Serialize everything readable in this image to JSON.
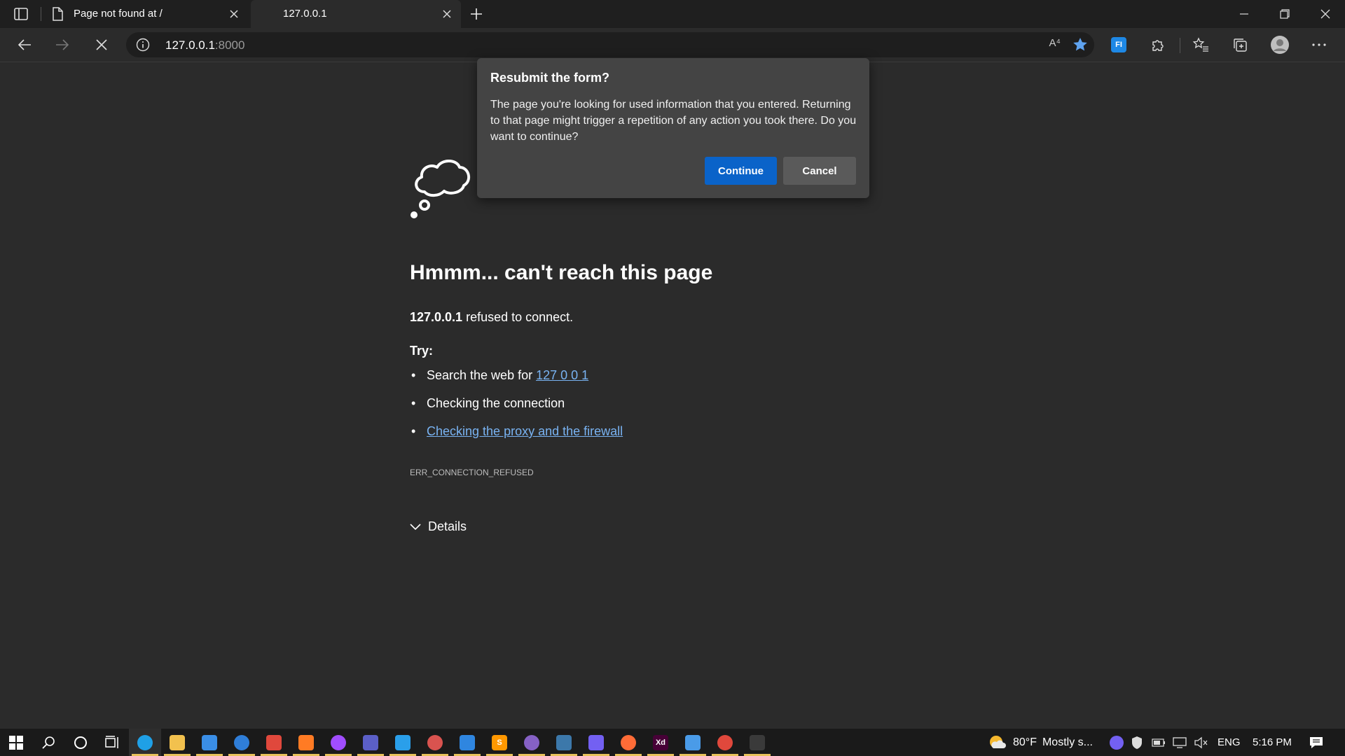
{
  "browser": {
    "tabs": [
      {
        "title": "Page not found at /",
        "active": false
      },
      {
        "title": "127.0.0.1",
        "active": true
      }
    ],
    "address": {
      "host": "127.0.0.1",
      "port": ":8000"
    },
    "read_aloud_glyph": "A⁴"
  },
  "error_page": {
    "heading": "Hmmm... can't reach this page",
    "host": "127.0.0.1",
    "refused_text": " refused to connect.",
    "try_label": "Try:",
    "suggestions": [
      {
        "prefix": "Search the web for ",
        "link": "127 0 0 1"
      },
      {
        "prefix": "Checking the connection",
        "link": ""
      },
      {
        "prefix": "",
        "link": "Checking the proxy and the firewall"
      }
    ],
    "error_code": "ERR_CONNECTION_REFUSED",
    "details_label": "Details"
  },
  "dialog": {
    "title": "Resubmit the form?",
    "message": "The page you're looking for used information that you entered. Returning to that page might trigger a repetition of any action you took there. Do you want to continue?",
    "continue_label": "Continue",
    "cancel_label": "Cancel"
  },
  "taskbar": {
    "apps": [
      {
        "name": "edge",
        "label": "",
        "color": "#1fa0e6",
        "active": true
      },
      {
        "name": "file-explorer",
        "label": "",
        "color": "#f2c14e",
        "active": false
      },
      {
        "name": "store",
        "label": "",
        "color": "#3a8ee6",
        "active": false
      },
      {
        "name": "mail",
        "label": "",
        "color": "#2f7ed8",
        "active": false
      },
      {
        "name": "chrome",
        "label": "",
        "color": "#e0483c",
        "active": false
      },
      {
        "name": "firefox",
        "label": "",
        "color": "#ff7b24",
        "active": false
      },
      {
        "name": "messenger",
        "label": "",
        "color": "#a14dff",
        "active": false
      },
      {
        "name": "teams",
        "label": "",
        "color": "#5b5fc7",
        "active": false
      },
      {
        "name": "vscode",
        "label": "",
        "color": "#2a9fea",
        "active": false
      },
      {
        "name": "app-cloud",
        "label": "",
        "color": "#d9534f",
        "active": false
      },
      {
        "name": "app-hex",
        "label": "",
        "color": "#2f86e0",
        "active": false
      },
      {
        "name": "sublime",
        "label": "S",
        "color": "#ff9800",
        "active": false
      },
      {
        "name": "visual-studio",
        "label": "",
        "color": "#8661c5",
        "active": false
      },
      {
        "name": "python",
        "label": "",
        "color": "#3c78aa",
        "active": false
      },
      {
        "name": "viber",
        "label": "",
        "color": "#7360f2",
        "active": false
      },
      {
        "name": "postman",
        "label": "",
        "color": "#ff6c37",
        "active": false
      },
      {
        "name": "adobe-xd",
        "label": "Xd",
        "color": "#470137",
        "active": false
      },
      {
        "name": "network-app",
        "label": "",
        "color": "#4a9be8",
        "active": false
      },
      {
        "name": "chrome-2",
        "label": "",
        "color": "#e0483c",
        "active": false
      },
      {
        "name": "terminal",
        "label": "",
        "color": "#3a3a3a",
        "active": false
      }
    ],
    "weather": {
      "temp": "80°F",
      "desc": "Mostly s..."
    },
    "language": "ENG",
    "time": "5:16 PM"
  }
}
